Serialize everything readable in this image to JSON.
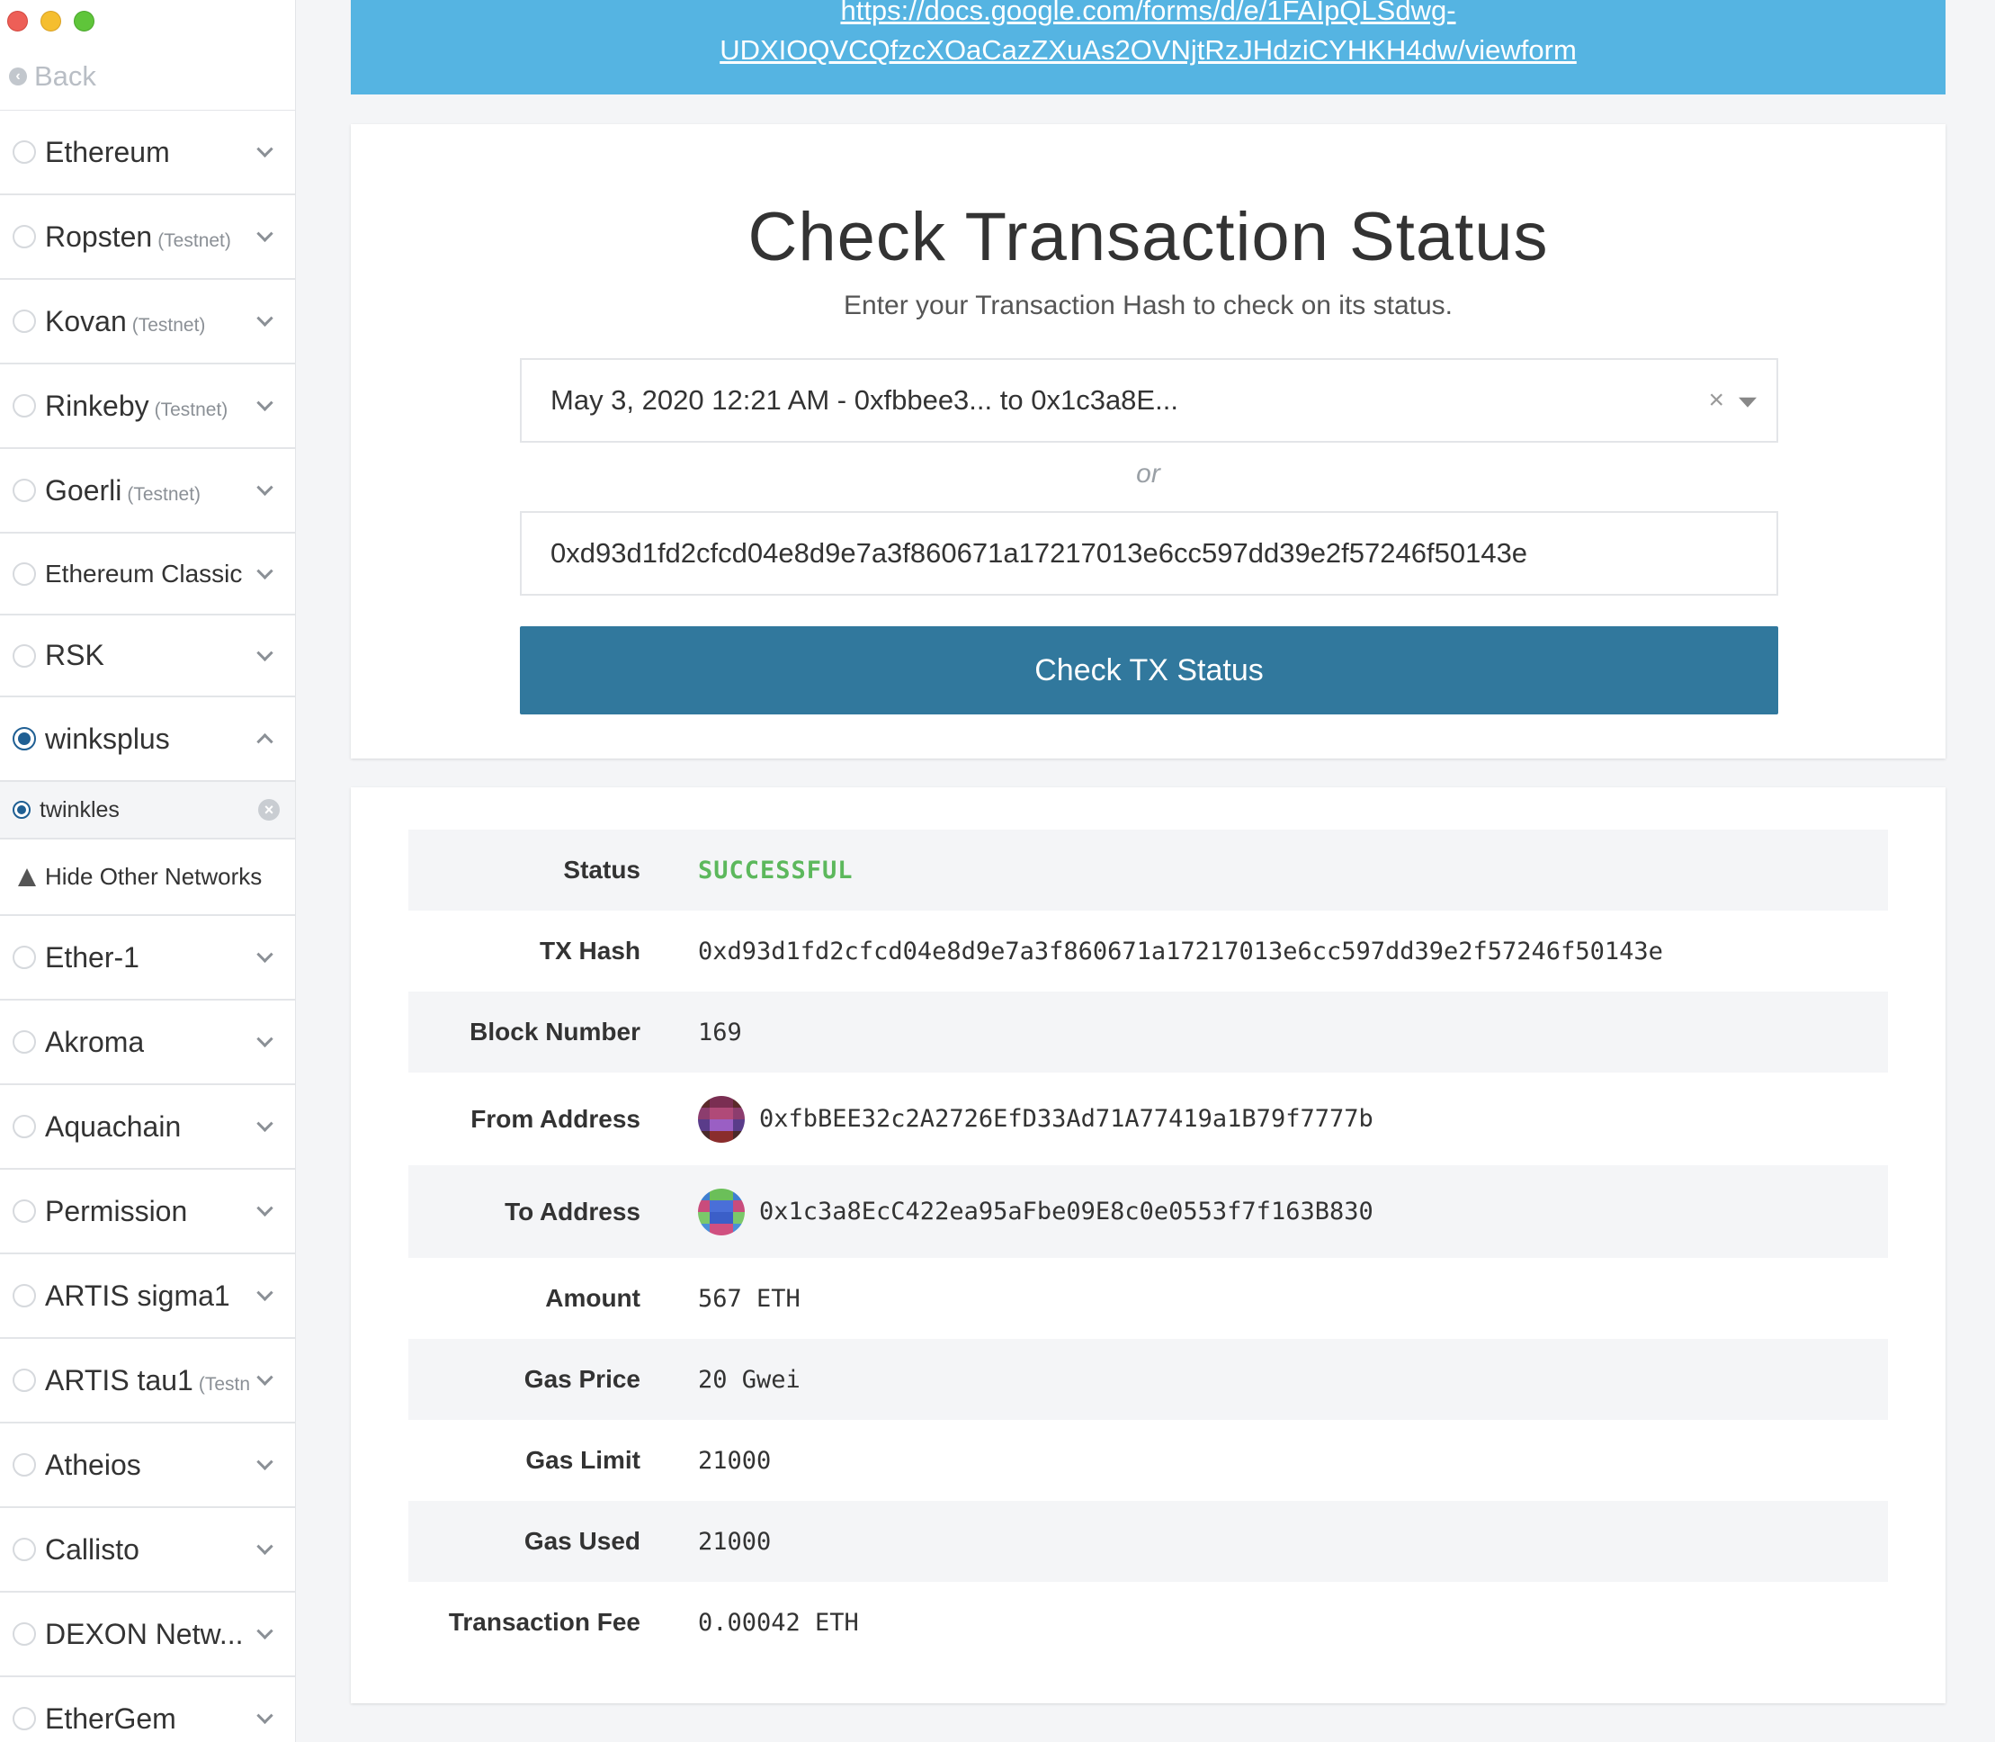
{
  "sidebar": {
    "back_label": "Back",
    "networks": [
      {
        "name": "Ethereum",
        "tag": "",
        "selected": false
      },
      {
        "name": "Ropsten",
        "tag": "(Testnet)",
        "selected": false
      },
      {
        "name": "Kovan",
        "tag": "(Testnet)",
        "selected": false
      },
      {
        "name": "Rinkeby",
        "tag": "(Testnet)",
        "selected": false
      },
      {
        "name": "Goerli",
        "tag": "(Testnet)",
        "selected": false
      },
      {
        "name": "Ethereum Classic",
        "tag": "",
        "selected": false
      },
      {
        "name": "RSK",
        "tag": "",
        "selected": false
      },
      {
        "name": "winksplus",
        "tag": "",
        "selected": true
      }
    ],
    "sub_node": "twinkles",
    "hide_other": "Hide Other Networks",
    "more_networks": [
      {
        "name": "Ether-1",
        "tag": ""
      },
      {
        "name": "Akroma",
        "tag": ""
      },
      {
        "name": "Aquachain",
        "tag": ""
      },
      {
        "name": "Permission",
        "tag": ""
      },
      {
        "name": "ARTIS sigma1",
        "tag": ""
      },
      {
        "name": "ARTIS tau1",
        "tag": "(Testn"
      },
      {
        "name": "Atheios",
        "tag": ""
      },
      {
        "name": "Callisto",
        "tag": ""
      },
      {
        "name": "DEXON Netw...",
        "tag": ""
      },
      {
        "name": "EtherGem",
        "tag": ""
      }
    ]
  },
  "banner": {
    "link_line1": "https://docs.google.com/forms/d/e/1FAIpQLSdwg-",
    "link_line2": "UDXIOQVCQfzcXOaCazZXuAs2OVNjtRzJHdziCYHKH4dw/viewform"
  },
  "check": {
    "title": "Check Transaction Status",
    "subtitle": "Enter your Transaction Hash to check on its status.",
    "selected_tx": "May 3, 2020 12:21 AM - 0xfbbee3... to 0x1c3a8E...",
    "or": "or",
    "hash_value": "0xd93d1fd2cfcd04e8d9e7a3f860671a17217013e6cc597dd39e2f57246f50143e",
    "button": "Check TX Status"
  },
  "result": {
    "rows": [
      {
        "label": "Status",
        "value": "SUCCESSFUL"
      },
      {
        "label": "TX Hash",
        "value": "0xd93d1fd2cfcd04e8d9e7a3f860671a17217013e6cc597dd39e2f57246f50143e"
      },
      {
        "label": "Block Number",
        "value": "169"
      },
      {
        "label": "From Address",
        "value": "0xfbBEE32c2A2726EfD33Ad71A77419a1B79f7777b"
      },
      {
        "label": "To Address",
        "value": "0x1c3a8EcC422ea95aFbe09E8c0e0553f7f163B830"
      },
      {
        "label": "Amount",
        "value": "567 ETH"
      },
      {
        "label": "Gas Price",
        "value": "20 Gwei"
      },
      {
        "label": "Gas Limit",
        "value": "21000"
      },
      {
        "label": "Gas Used",
        "value": "21000"
      },
      {
        "label": "Transaction Fee",
        "value": "0.00042 ETH"
      }
    ]
  },
  "colors": {
    "banner": "#55b4e2",
    "button": "#31789d",
    "success": "#5cb85c",
    "radio_selected": "#1f5f93"
  },
  "icons": {
    "back": "back-arrow-icon",
    "chevron": "chevron-down-icon",
    "chevron_open": "chevron-up-icon",
    "remove": "remove-circle-icon",
    "hide": "flask-icon",
    "clear": "clear-icon",
    "dropdown": "dropdown-caret-icon",
    "identicon": "identicon-icon"
  }
}
